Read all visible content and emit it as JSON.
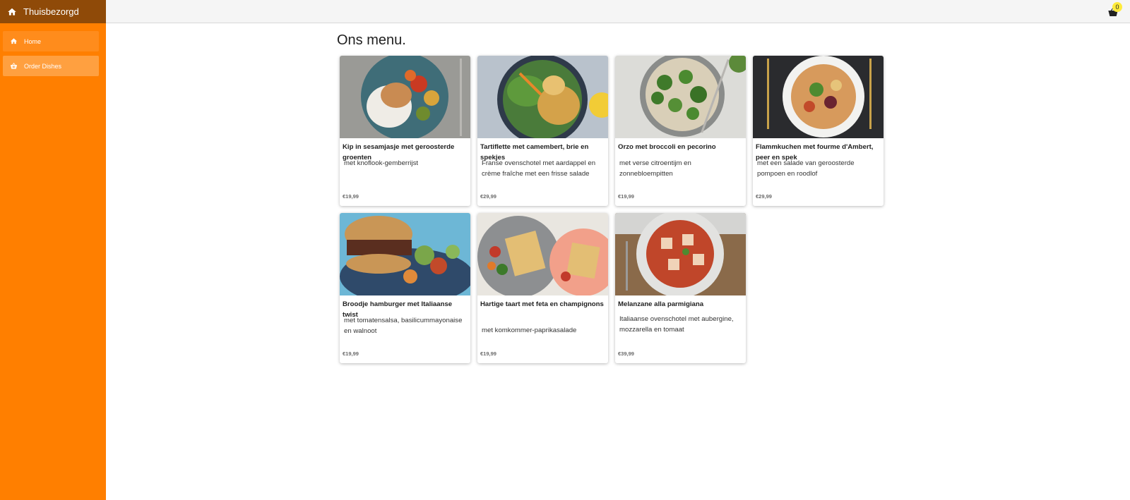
{
  "app": {
    "brand": "Thuisbezorgd",
    "brand_icon": "home-icon"
  },
  "sidebar": {
    "items": [
      {
        "label": "Home",
        "icon": "home-icon"
      },
      {
        "label": "Order Dishes",
        "icon": "basket-icon"
      }
    ]
  },
  "topbar": {
    "cart_count": "0",
    "cart_icon": "cart-icon"
  },
  "page": {
    "title": "Ons menu."
  },
  "colors": {
    "sidebar": "#ff7f00",
    "brand_bar": "#8f4a08",
    "badge": "#ffeb3b"
  },
  "dishes": [
    {
      "name": "Kip in sesamjasje met geroosterde groenten",
      "description": "met knoflook-gemberrijst",
      "price": "€19,99"
    },
    {
      "name": "Tartiflette met camembert, brie en spekjes",
      "description": "Franse ovenschotel met aardappel en crème fraîche met een frisse salade",
      "price": "€29,99"
    },
    {
      "name": "Orzo met broccoli en pecorino",
      "description": "met verse citroentijm en zonnebloempitten",
      "price": "€19,99"
    },
    {
      "name": "Flammkuchen met fourme d'Ambert, peer en spek",
      "description": "met een salade van geroosterde pompoen en roodlof",
      "price": "€29,99"
    },
    {
      "name": "Broodje hamburger met Italiaanse twist",
      "description": "met tomatensalsa, basilicummayonaise en walnoot",
      "price": "€19,99"
    },
    {
      "name": "Hartige taart met feta en champignons",
      "description": "met komkommer-paprikasalade",
      "price": "€19,99"
    },
    {
      "name": "Melanzane alla parmigiana",
      "description": "Italiaanse ovenschotel met aubergine, mozzarella en tomaat",
      "price": "€39,99"
    }
  ]
}
